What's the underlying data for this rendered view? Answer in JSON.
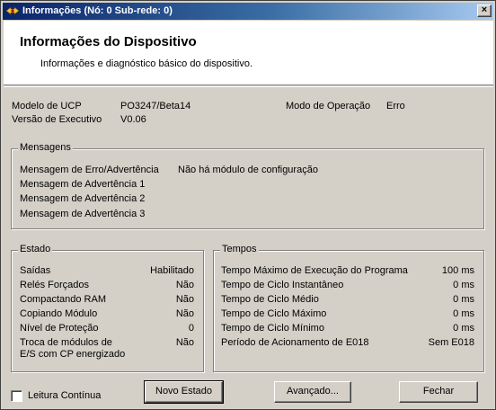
{
  "window": {
    "title": "Informações (Nó: 0 Sub-rede: 0)",
    "close_glyph": "×",
    "app_icon": "network-arrows-icon"
  },
  "header": {
    "title": "Informações do Dispositivo",
    "subtitle": "Informações e diagnóstico básico do dispositivo."
  },
  "device": {
    "model_label": "Modelo de UCP",
    "model_value": "PO3247/Beta14",
    "version_label": "Versão de Executivo",
    "version_value": "V0.06",
    "mode_label": "Modo de Operação",
    "mode_value": "Erro"
  },
  "messages": {
    "title": "Mensagens",
    "items": [
      {
        "label": "Mensagem de Erro/Advertência",
        "value": "Não há módulo de configuração"
      },
      {
        "label": "Mensagem de Advertência 1",
        "value": ""
      },
      {
        "label": "Mensagem de Advertência 2",
        "value": ""
      },
      {
        "label": "Mensagem de Advertência 3",
        "value": ""
      }
    ]
  },
  "estado": {
    "title": "Estado",
    "items": [
      {
        "label": "Saídas",
        "value": "Habilitado"
      },
      {
        "label": "Relés Forçados",
        "value": "Não"
      },
      {
        "label": "Compactando RAM",
        "value": "Não"
      },
      {
        "label": "Copiando Módulo",
        "value": "Não"
      },
      {
        "label": "Nível de Proteção",
        "value": "0"
      },
      {
        "label_line1": "Troca de módulos de",
        "label_line2": "E/S com CP energizado",
        "value": "Não"
      }
    ]
  },
  "tempos": {
    "title": "Tempos",
    "items": [
      {
        "label": "Tempo Máximo de Execução do Programa",
        "value": "100 ms"
      },
      {
        "label": "Tempo de Ciclo Instantâneo",
        "value": "0 ms"
      },
      {
        "label": "Tempo de Ciclo Médio",
        "value": "0 ms"
      },
      {
        "label": "Tempo de Ciclo Máximo",
        "value": "0 ms"
      },
      {
        "label": "Tempo de Ciclo Mínimo",
        "value": "0 ms"
      },
      {
        "label": "Período de Acionamento de E018",
        "value": "Sem E018"
      }
    ]
  },
  "footer": {
    "checkbox_label": "Leitura Contínua",
    "checkbox_checked": false,
    "btn_novo_estado": "Novo Estado",
    "btn_avancado": "Avançado...",
    "btn_fechar": "Fechar"
  }
}
